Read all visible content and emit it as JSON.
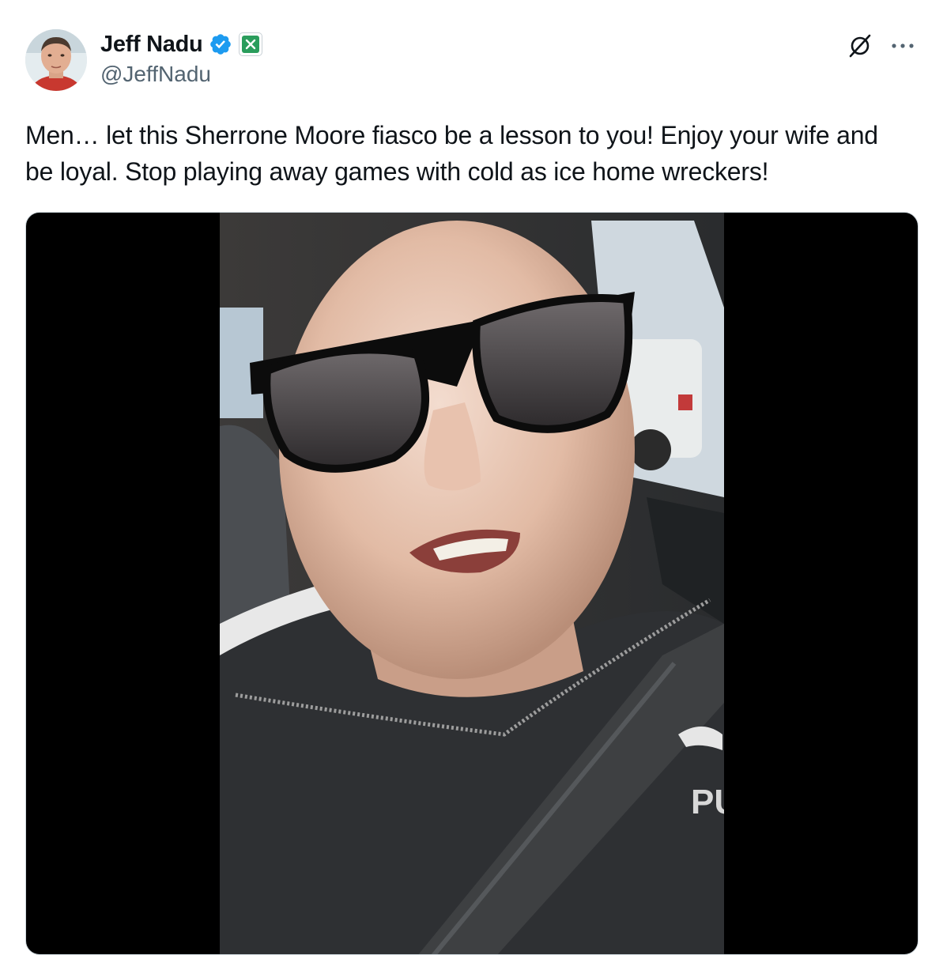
{
  "author": {
    "display_name": "Jeff Nadu",
    "handle": "@JeffNadu",
    "verified": true,
    "affiliate_badge": "x-badge-icon"
  },
  "header_actions": {
    "grok_icon": "grok-icon",
    "more_icon": "more-icon"
  },
  "tweet": {
    "text": "Men… let this Sherrone Moore fiasco be a lesson to you! Enjoy your wife and be loyal. Stop playing away games with cold as ice home wreckers!"
  },
  "media": {
    "type": "video",
    "shirt_text": "PU"
  },
  "colors": {
    "text_primary": "#0f1419",
    "text_secondary": "#536471",
    "verified_blue": "#1d9bf0",
    "badge_green": "#2a9d5c",
    "media_background": "#000000"
  }
}
